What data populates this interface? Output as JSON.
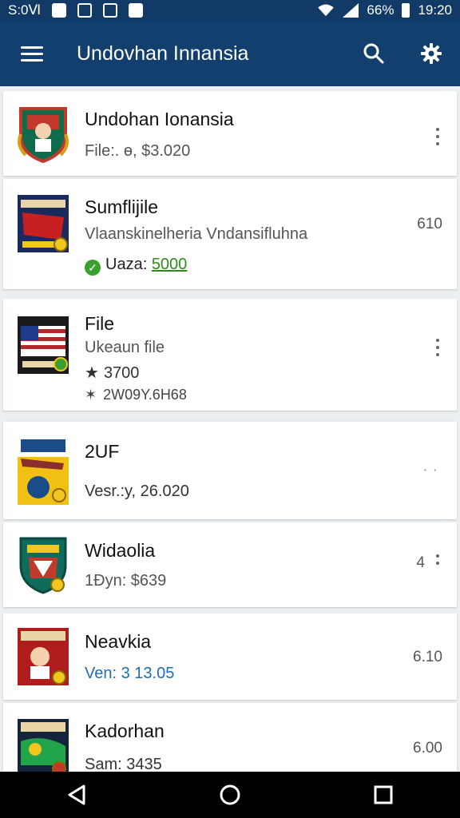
{
  "status_bar": {
    "left_text": "S:0Ⅵ",
    "battery_pct": "66%",
    "time": "19:20"
  },
  "app_bar": {
    "title": "Undovhan Innansia",
    "menu_icon": "hamburger-menu-icon",
    "search_icon": "search-icon",
    "settings_icon": "gear-icon"
  },
  "list": {
    "items": [
      {
        "title": "Undohan Ionansia",
        "line1": "File:. ɵ, $3.020",
        "right": "",
        "thumb_colors": [
          "#c0392b",
          "#0e6b4c"
        ]
      },
      {
        "title": "Sumflijile",
        "line1": "Vlaanskinelheria Vndansifluhna",
        "status_label": "Uaza:",
        "status_value": "5000",
        "right": "610",
        "thumb_colors": [
          "#1b2a5c",
          "#c82020"
        ]
      },
      {
        "title": "File",
        "line1": "Ukeaun file",
        "line2": "3700",
        "line3": "2W09Y.6H68",
        "right": "",
        "thumb_colors": [
          "#1a1a1a",
          "#b02a2a"
        ]
      },
      {
        "title": "2UF",
        "line1": "Vesr.:y, 26.020",
        "right": "",
        "thumb_colors": [
          "#f2c012",
          "#1a4c8a"
        ]
      },
      {
        "title": "Widaolia",
        "line1": "1Ðyn: $639",
        "right": "4",
        "thumb_colors": [
          "#0f6b5c",
          "#c0392b"
        ]
      },
      {
        "title": "Neavkia",
        "line1": "Ven: 3 13.05",
        "right": "6.10",
        "thumb_colors": [
          "#b01d1d",
          "#f0c61f"
        ]
      },
      {
        "title": "Kadorhan",
        "line1": "Sam: 3435",
        "right": "6.00",
        "thumb_colors": [
          "#15233b",
          "#22a44a"
        ]
      }
    ]
  },
  "nav_bar": {
    "back_icon": "back-triangle-icon",
    "home_icon": "home-circle-icon",
    "recents_icon": "recents-square-icon"
  }
}
